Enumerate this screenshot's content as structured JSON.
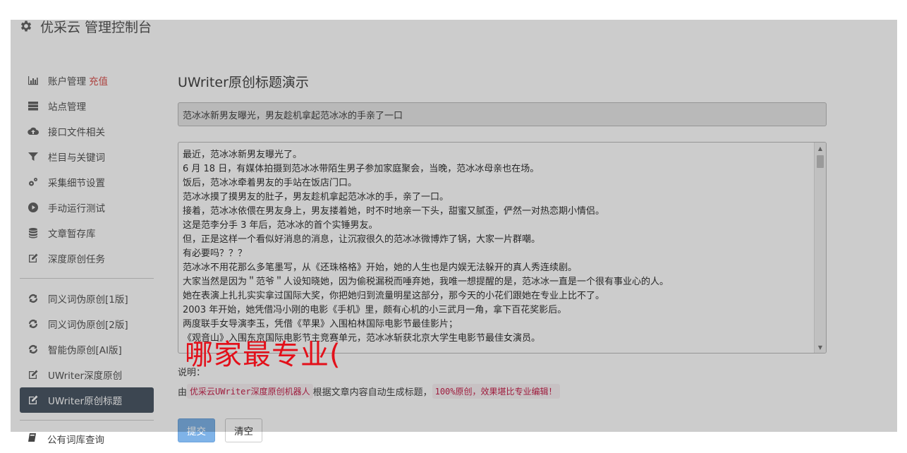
{
  "header": {
    "title": "优采云 管理控制台"
  },
  "sidebar": {
    "items": [
      {
        "label": "账户管理",
        "extra": "充值",
        "icon": "bar-chart-icon"
      },
      {
        "label": "站点管理",
        "icon": "server-icon"
      },
      {
        "label": "接口文件相关",
        "icon": "cloud-upload-icon"
      },
      {
        "label": "栏目与关键词",
        "icon": "filter-icon"
      },
      {
        "label": "采集细节设置",
        "icon": "cogs-icon"
      },
      {
        "label": "手动运行测试",
        "icon": "play-circle-icon"
      },
      {
        "label": "文章暂存库",
        "icon": "database-icon"
      },
      {
        "label": "深度原创任务",
        "icon": "edit-icon"
      }
    ],
    "items2": [
      {
        "label": "同义词伪原创[1版]",
        "icon": "refresh-icon"
      },
      {
        "label": "同义词伪原创[2版]",
        "icon": "refresh-icon"
      },
      {
        "label": "智能伪原创[AI版]",
        "icon": "refresh-icon"
      },
      {
        "label": "UWriter深度原创",
        "icon": "edit-icon"
      },
      {
        "label": "UWriter原创标题",
        "icon": "edit-icon",
        "active": true
      }
    ],
    "footer_item": {
      "label": "公有词库查询",
      "icon": "book-icon"
    }
  },
  "main": {
    "title": "UWriter原创标题演示",
    "title_value": "范冰冰新男友曝光，男友趁机拿起范冰冰的手亲了一口",
    "article_lines": [
      "最近，范冰冰新男友曝光了。",
      "6 月 18 日，有媒体拍摄到范冰冰带陌生男子参加家庭聚会，当晚，范冰冰母亲也在场。",
      "饭后，范冰冰牵着男友的手站在饭店门口。",
      "范冰冰摸了摸男友的肚子，男友趁机拿起范冰冰的手，亲了一口。",
      "接着，范冰冰依偎在男友身上，男友搂着她，时不时地亲一下头，甜蜜又腻歪，俨然一对热恋期小情侣。",
      "这是范李分手 3 年后，范冰冰的首个实锤男友。",
      "但，正是这样一个看似好消息的消息，让沉寂很久的范冰冰微博炸了锅，大家一片群嘲。",
      "有必要吗？？？",
      "范冰冰不用花那么多笔墨写，从《还珠格格》开始，她的人生也是内娱无法躲开的真人秀连续剧。",
      "大家当然是因为＂范爷＂人设知晓她，因为偷税漏税而唾弃她，我唯一想提醒的是，范冰冰一直是一个很有事业心的人。",
      "她在表演上扎扎实实拿过国际大奖，你把她归到流量明星这部分，那今天的小花们跟她在专业上比不了。",
      "2003 年开始，她凭借冯小刚的电影《手机》里，颇有心机的小三武月一角，拿下百花奖影后。",
      "两度联手女导演李玉，凭借《苹果》入围柏林国际电影节最佳影片；",
      "《观音山》入围东京国际电影节主竞赛单元，范冰冰斩获北京大学生电影节最佳女演员。"
    ],
    "note_label": "说明：",
    "note_prefix": "由",
    "note_code1": "优采云UWriter深度原创机器人",
    "note_mid": "根据文章内容自动生成标题，",
    "note_code2": "100%原创，效果堪比专业编辑！",
    "submit_label": "提交",
    "clear_label": "清空"
  },
  "watermark": "哪家最专业(",
  "colors": {
    "active_bg": "#4c5866",
    "primary": "#7fb3e8",
    "recharge": "#d9534f",
    "code": "#c7254e",
    "watermark": "#e3101a"
  }
}
